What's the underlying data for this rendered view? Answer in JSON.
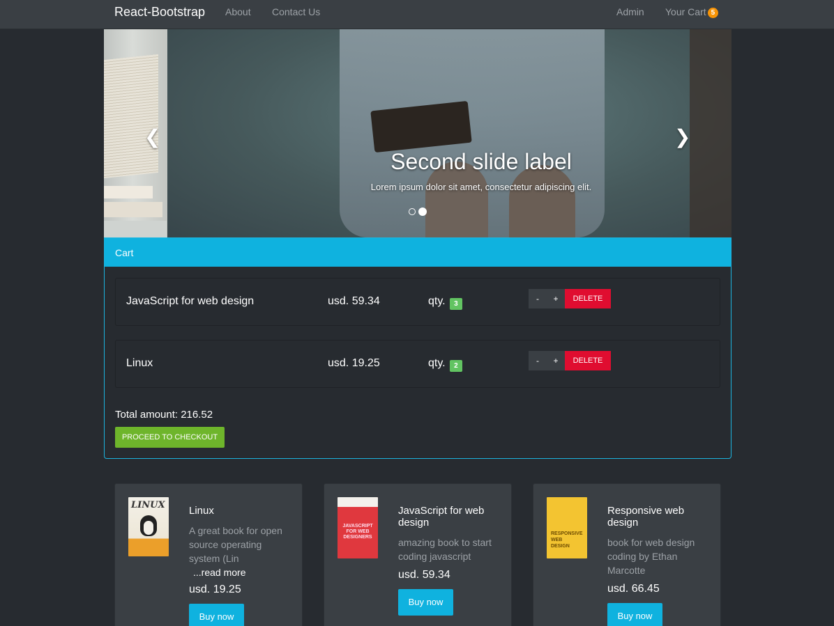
{
  "navbar": {
    "brand": "React-Bootstrap",
    "links": [
      {
        "label": "About"
      },
      {
        "label": "Contact Us"
      }
    ],
    "admin": "Admin",
    "cart_label": "Your Cart",
    "cart_count": "5"
  },
  "carousel": {
    "caption_title": "Second slide label",
    "caption_text": "Lorem ipsum dolor sit amet, consectetur adipiscing elit.",
    "prev_icon": "chevron-left-icon",
    "next_icon": "chevron-right-icon",
    "active_index": 1,
    "slide_count": 2
  },
  "cart": {
    "heading": "Cart",
    "items": [
      {
        "title": "JavaScript for web design",
        "price": "usd. 59.34",
        "qty_label": "qty.",
        "qty": "3"
      },
      {
        "title": "Linux",
        "price": "usd. 19.25",
        "qty_label": "qty.",
        "qty": "2"
      }
    ],
    "minus_label": "-",
    "plus_label": "+",
    "delete_label": "DELETE",
    "total": "Total amount: 216.52",
    "checkout_label": "PROCEED TO CHECKOUT"
  },
  "products": [
    {
      "title": "Linux",
      "description": "A great book for open source operating system (Lin",
      "more": "...read more",
      "price": "usd. 19.25",
      "buy_label": "Buy now",
      "cover_text": "LINUX"
    },
    {
      "title": "JavaScript for web design",
      "description": "amazing book to start coding javascript",
      "more": "",
      "price": "usd. 59.34",
      "buy_label": "Buy now",
      "cover_text": "JAVASCRIPT FOR WEB DESIGNERS"
    },
    {
      "title": "Responsive web design",
      "description": "book for web design coding by Ethan Marcotte",
      "more": "",
      "price": "usd. 66.45",
      "buy_label": "Buy now",
      "cover_text": "RESPONSIVE WEB DESIGN"
    }
  ],
  "colors": {
    "background": "#272b30",
    "navbar": "#3a3f44",
    "primary": "#0fb2df",
    "danger": "#e00d30",
    "success": "#6eb52b",
    "badge_cart": "#f89406",
    "badge_qty": "#62c462"
  }
}
